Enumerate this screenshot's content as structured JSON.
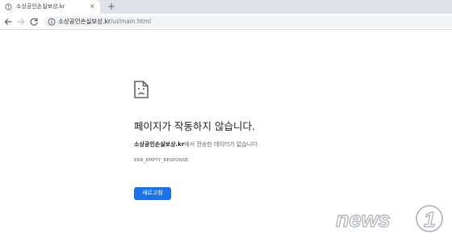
{
  "tab": {
    "title": "소상공인손실보상.kr",
    "close_glyph": "×"
  },
  "new_tab_glyph": "+",
  "address_bar": {
    "host": "소상공인손실보상.kr",
    "path": "/ui/main.html"
  },
  "error": {
    "title": "페이지가 작동하지 않습니다.",
    "host_strong": "소상공인손실보상.kr",
    "desc_rest": "에서 전송한 데이터가 없습니다.",
    "code": "ERR_EMPTY_RESPONSE",
    "reload_label": "새로고침"
  },
  "watermark": {
    "brand": "news",
    "digit": "1"
  },
  "colors": {
    "accent": "#1a73e8",
    "tabstrip": "#dee1e6",
    "omnibox": "#f1f3f4"
  },
  "icons": {
    "favicon": "error-globe-icon",
    "back": "back-arrow-icon",
    "forward": "forward-arrow-icon",
    "reload": "reload-icon",
    "site_info": "info-icon",
    "sad_page": "sad-page-icon"
  }
}
